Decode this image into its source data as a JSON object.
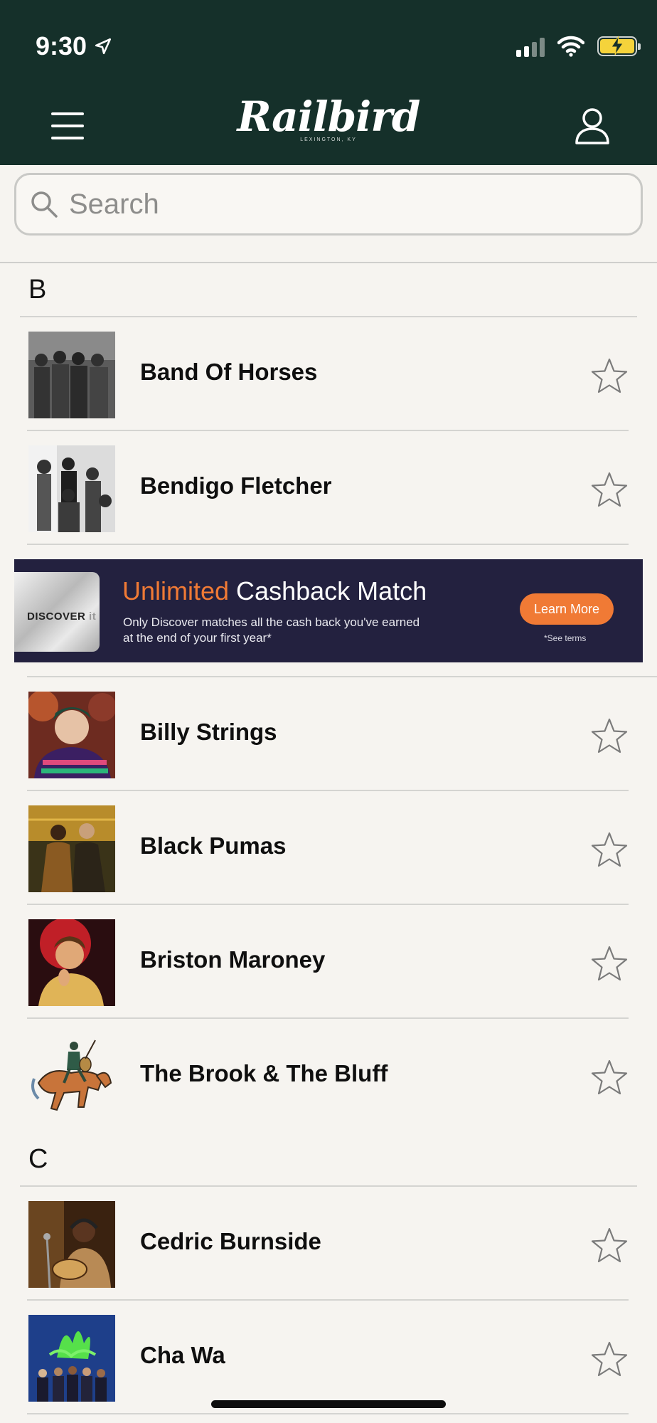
{
  "status": {
    "time": "9:30"
  },
  "header": {
    "logo": "Railbird",
    "logo_sub": "LEXINGTON, KY"
  },
  "search": {
    "placeholder": "Search"
  },
  "sections": [
    {
      "letter": "B"
    },
    {
      "letter": "C"
    }
  ],
  "artists": [
    {
      "name": "Band Of Horses"
    },
    {
      "name": "Bendigo Fletcher"
    },
    {
      "name": "Billy Strings"
    },
    {
      "name": "Black Pumas"
    },
    {
      "name": "Briston Maroney"
    },
    {
      "name": "The Brook & The Bluff"
    },
    {
      "name": "Cedric Burnside"
    },
    {
      "name": "Cha Wa"
    }
  ],
  "ad": {
    "card_brand": "DISCOVER",
    "card_suffix": "it",
    "headline_accent": "Unlimited",
    "headline_rest": " Cashback Match",
    "subtext": "Only Discover matches all the cash back you've earned at the end of your first year*",
    "cta": "Learn More",
    "terms": "*See terms",
    "accent_color": "#f07a35",
    "background_color": "#23213f"
  },
  "colors": {
    "header": "#15302a",
    "background": "#f6f4f0",
    "battery": "#f5d33b"
  }
}
